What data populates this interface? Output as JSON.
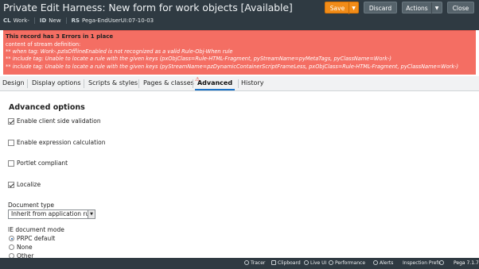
{
  "header": {
    "title": "Private Edit Harness: New form for work objects [Available]",
    "class_key": "CL",
    "class_value": "Work-",
    "id_key": "ID",
    "id_value": "New",
    "rs_key": "RS",
    "rs_value": "Pega-EndUserUI:07-10-03",
    "buttons": {
      "save": "Save",
      "discard": "Discard",
      "actions": "Actions",
      "close": "Close"
    },
    "caret": "▼"
  },
  "errors": {
    "heading": "This record has 3 Errors in 1 place",
    "subheading": "content of stream definition:",
    "lines": [
      "** when tag: Work-.pzIsOfflineEnabled is not recognized as a valid Rule-Obj-When rule",
      "** include tag: Unable to locate a rule with the given keys (pxObjClass=Rule-HTML-Fragment, pyStreamName=pyMetaTags, pyClassName=Work-)",
      "** include tag: Unable to locate a rule with the given keys (pyStreamName=pzDynamicContainerScriptFrameLess, pxObjClass=Rule-HTML-Fragment, pyClassName=Work-)"
    ],
    "bg_color": "#f46e63"
  },
  "tabs": [
    {
      "label": "Design"
    },
    {
      "label": "Display options"
    },
    {
      "label": "Scripts & styles"
    },
    {
      "label": "Pages & classes"
    },
    {
      "label": "Advanced",
      "warning": "⚠"
    },
    {
      "label": "History"
    }
  ],
  "content": {
    "title": "Advanced options",
    "checkboxes": [
      {
        "label": "Enable client side validation",
        "checked": true
      },
      {
        "label": "Enable expression calculation",
        "checked": false
      },
      {
        "label": "Portlet compliant",
        "checked": false
      },
      {
        "label": "Localize",
        "checked": true
      }
    ],
    "document_type_label": "Document type",
    "document_type_value": "Inherit from application rule",
    "ie_mode_label": "IE document mode",
    "ie_options": [
      {
        "label": "PRPC default",
        "checked": true
      },
      {
        "label": "None",
        "checked": false
      },
      {
        "label": "Other",
        "checked": false
      }
    ]
  },
  "statusbar": {
    "items": [
      "Tracer",
      "Clipboard",
      "Live UI",
      "Performance",
      "Alerts",
      "Inspection Prefs"
    ],
    "version": "Pega 7.1.7"
  },
  "colors": {
    "header_bg": "#2f3a42",
    "accent_orange": "#f28c18",
    "tab_active_underline": "#1b73c8"
  }
}
